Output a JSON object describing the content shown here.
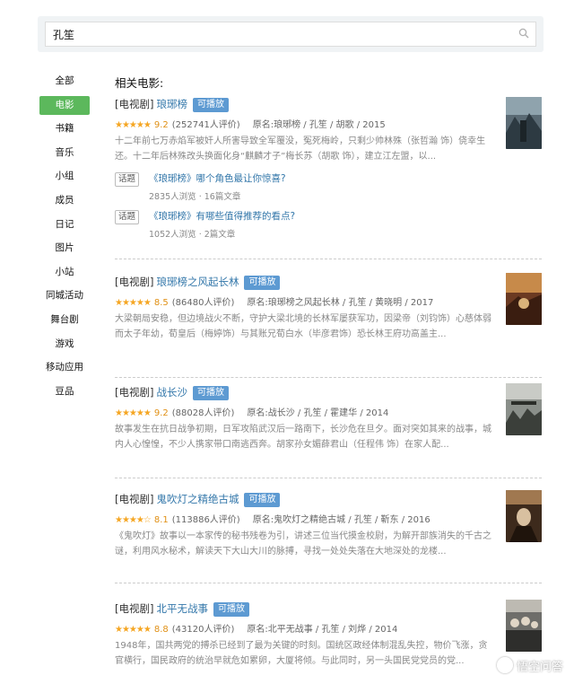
{
  "search": {
    "value": "孔笙"
  },
  "sidebar": {
    "items": [
      {
        "label": "全部",
        "active": false
      },
      {
        "label": "电影",
        "active": true
      },
      {
        "label": "书籍",
        "active": false
      },
      {
        "label": "音乐",
        "active": false
      },
      {
        "label": "小组",
        "active": false
      },
      {
        "label": "成员",
        "active": false
      },
      {
        "label": "日记",
        "active": false
      },
      {
        "label": "图片",
        "active": false
      },
      {
        "label": "小站",
        "active": false
      },
      {
        "label": "同城活动",
        "active": false
      },
      {
        "label": "舞台剧",
        "active": false
      },
      {
        "label": "游戏",
        "active": false
      },
      {
        "label": "移动应用",
        "active": false
      },
      {
        "label": "豆品",
        "active": false
      }
    ]
  },
  "main": {
    "section_title": "相关电影:",
    "results": [
      {
        "category": "[电视剧]",
        "title": "琅琊榜",
        "badge": "可播放",
        "rating": 9.2,
        "stars": "★★★★★",
        "score": "9.2",
        "votes": "(252741人评价)",
        "original": "原名:琅琊榜 / 孔笙 / 胡歌 / 2015",
        "description": "十二年前七万赤焰军被奸人所害导致全军覆没，冤死梅岭，只剩少帅林殊（张哲瀚 饰）侥幸生还。十二年后林殊改头换面化身“麒麟才子”梅长苏（胡歌 饰），建立江左盟，以...",
        "topics": [
          {
            "tag": "话题",
            "title": "《琅琊榜》哪个角色最让你惊喜?",
            "stats": "2835人浏览 · 16篇文章"
          },
          {
            "tag": "话题",
            "title": "《琅琊榜》有哪些值得推荐的看点?",
            "stats": "1052人浏览 · 2篇文章"
          }
        ]
      },
      {
        "category": "[电视剧]",
        "title": "琅琊榜之风起长林",
        "badge": "可播放",
        "rating": 8.5,
        "stars": "★★★★★",
        "score": "8.5",
        "votes": "(86480人评价)",
        "original": "原名:琅琊榜之风起长林 / 孔笙 / 黄晓明 / 2017",
        "description": "大梁朝局安稳，但边境战火不断，守护大梁北境的长林军屡获军功，因梁帝（刘钧饰）心慈体弱而太子年幼，荀皇后（梅婷饰）与其账兄荀白水（毕彦君饰）恐长林王府功高盖主..."
      },
      {
        "category": "[电视剧]",
        "title": "战长沙",
        "badge": "可播放",
        "rating": 9.2,
        "stars": "★★★★★",
        "score": "9.2",
        "votes": "(88028人评价)",
        "original": "原名:战长沙 / 孔笙 / 霍建华 / 2014",
        "description": "故事发生在抗日战争初期，日军攻陷武汉后一路南下，长沙危在旦夕。面对突如其来的战事，城内人心惶惶，不少人携家带口南逃西奔。胡家孙女媚薛君山（任程伟 饰）在家人配..."
      },
      {
        "category": "[电视剧]",
        "title": "鬼吹灯之精绝古城",
        "badge": "可播放",
        "rating": 8.1,
        "stars": "★★★★☆",
        "score": "8.1",
        "votes": "(113886人评价)",
        "original": "原名:鬼吹灯之精绝古城 / 孔笙 / 靳东 / 2016",
        "description": "《鬼吹灯》故事以一本家传的秘书残卷为引，讲述三位当代摸金校尉，为解开部族消失的千古之谜，利用风水秘术，解读天下大山大川的脉搏，寻找一处处失落在大地深处的龙楼..."
      },
      {
        "category": "[电视剧]",
        "title": "北平无战事",
        "badge": "可播放",
        "rating": 8.8,
        "stars": "★★★★★",
        "score": "8.8",
        "votes": "(43120人评价)",
        "original": "原名:北平无战事 / 孔笙 / 刘烨 / 2014",
        "description": "1948年，国共两党的搏杀已经到了最为关键的时刻。国统区政经体制混乱失控，物价飞涨，贪官横行，国民政府的统治早就危如累卵，大厦将倾。与此同时，另一头国民党党员的党..."
      }
    ]
  },
  "watermark": {
    "text": "悟空问答"
  },
  "colors": {
    "accent_green": "#5cb85c",
    "link_blue": "#3377aa",
    "badge_blue": "#5d9ad2",
    "star_orange": "#f5a623"
  }
}
